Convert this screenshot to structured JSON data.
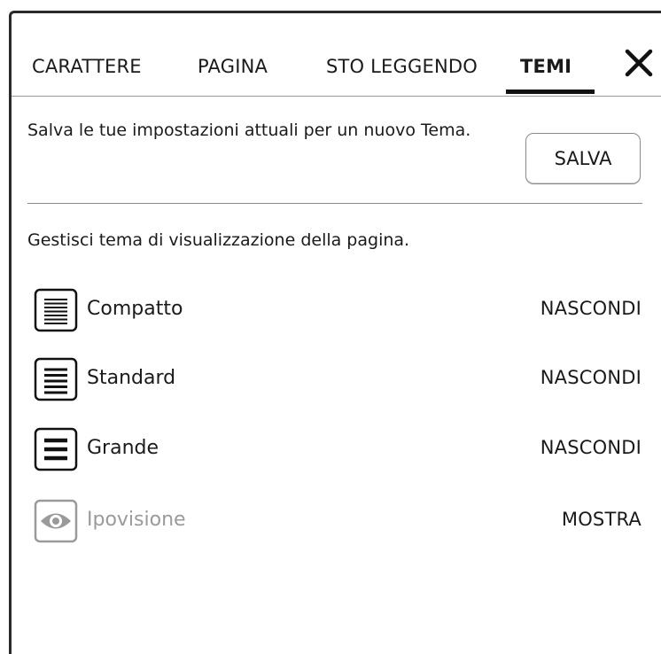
{
  "tabs": [
    {
      "label": "CARATTERE",
      "active": false
    },
    {
      "label": "PAGINA",
      "active": false
    },
    {
      "label": "STO LEGGENDO",
      "active": false
    },
    {
      "label": "TEMI",
      "active": true
    }
  ],
  "save_section": {
    "description": "Salva le tue impostazioni attuali per un nuovo Tema.",
    "button_label": "SALVA"
  },
  "manage_section": {
    "description": "Gestisci tema di visualizzazione della pagina."
  },
  "themes": [
    {
      "name": "Compatto",
      "action": "NASCONDI",
      "icon": "compact-lines-icon"
    },
    {
      "name": "Standard",
      "action": "NASCONDI",
      "icon": "standard-lines-icon"
    },
    {
      "name": "Grande",
      "action": "NASCONDI",
      "icon": "large-lines-icon"
    },
    {
      "name": "Ipovisione",
      "action": "MOSTRA",
      "icon": "eye-icon",
      "hidden": true
    }
  ],
  "colors": {
    "text": "#1a1a1a",
    "muted": "#9a9a9a",
    "divider": "#8a8a8a"
  }
}
